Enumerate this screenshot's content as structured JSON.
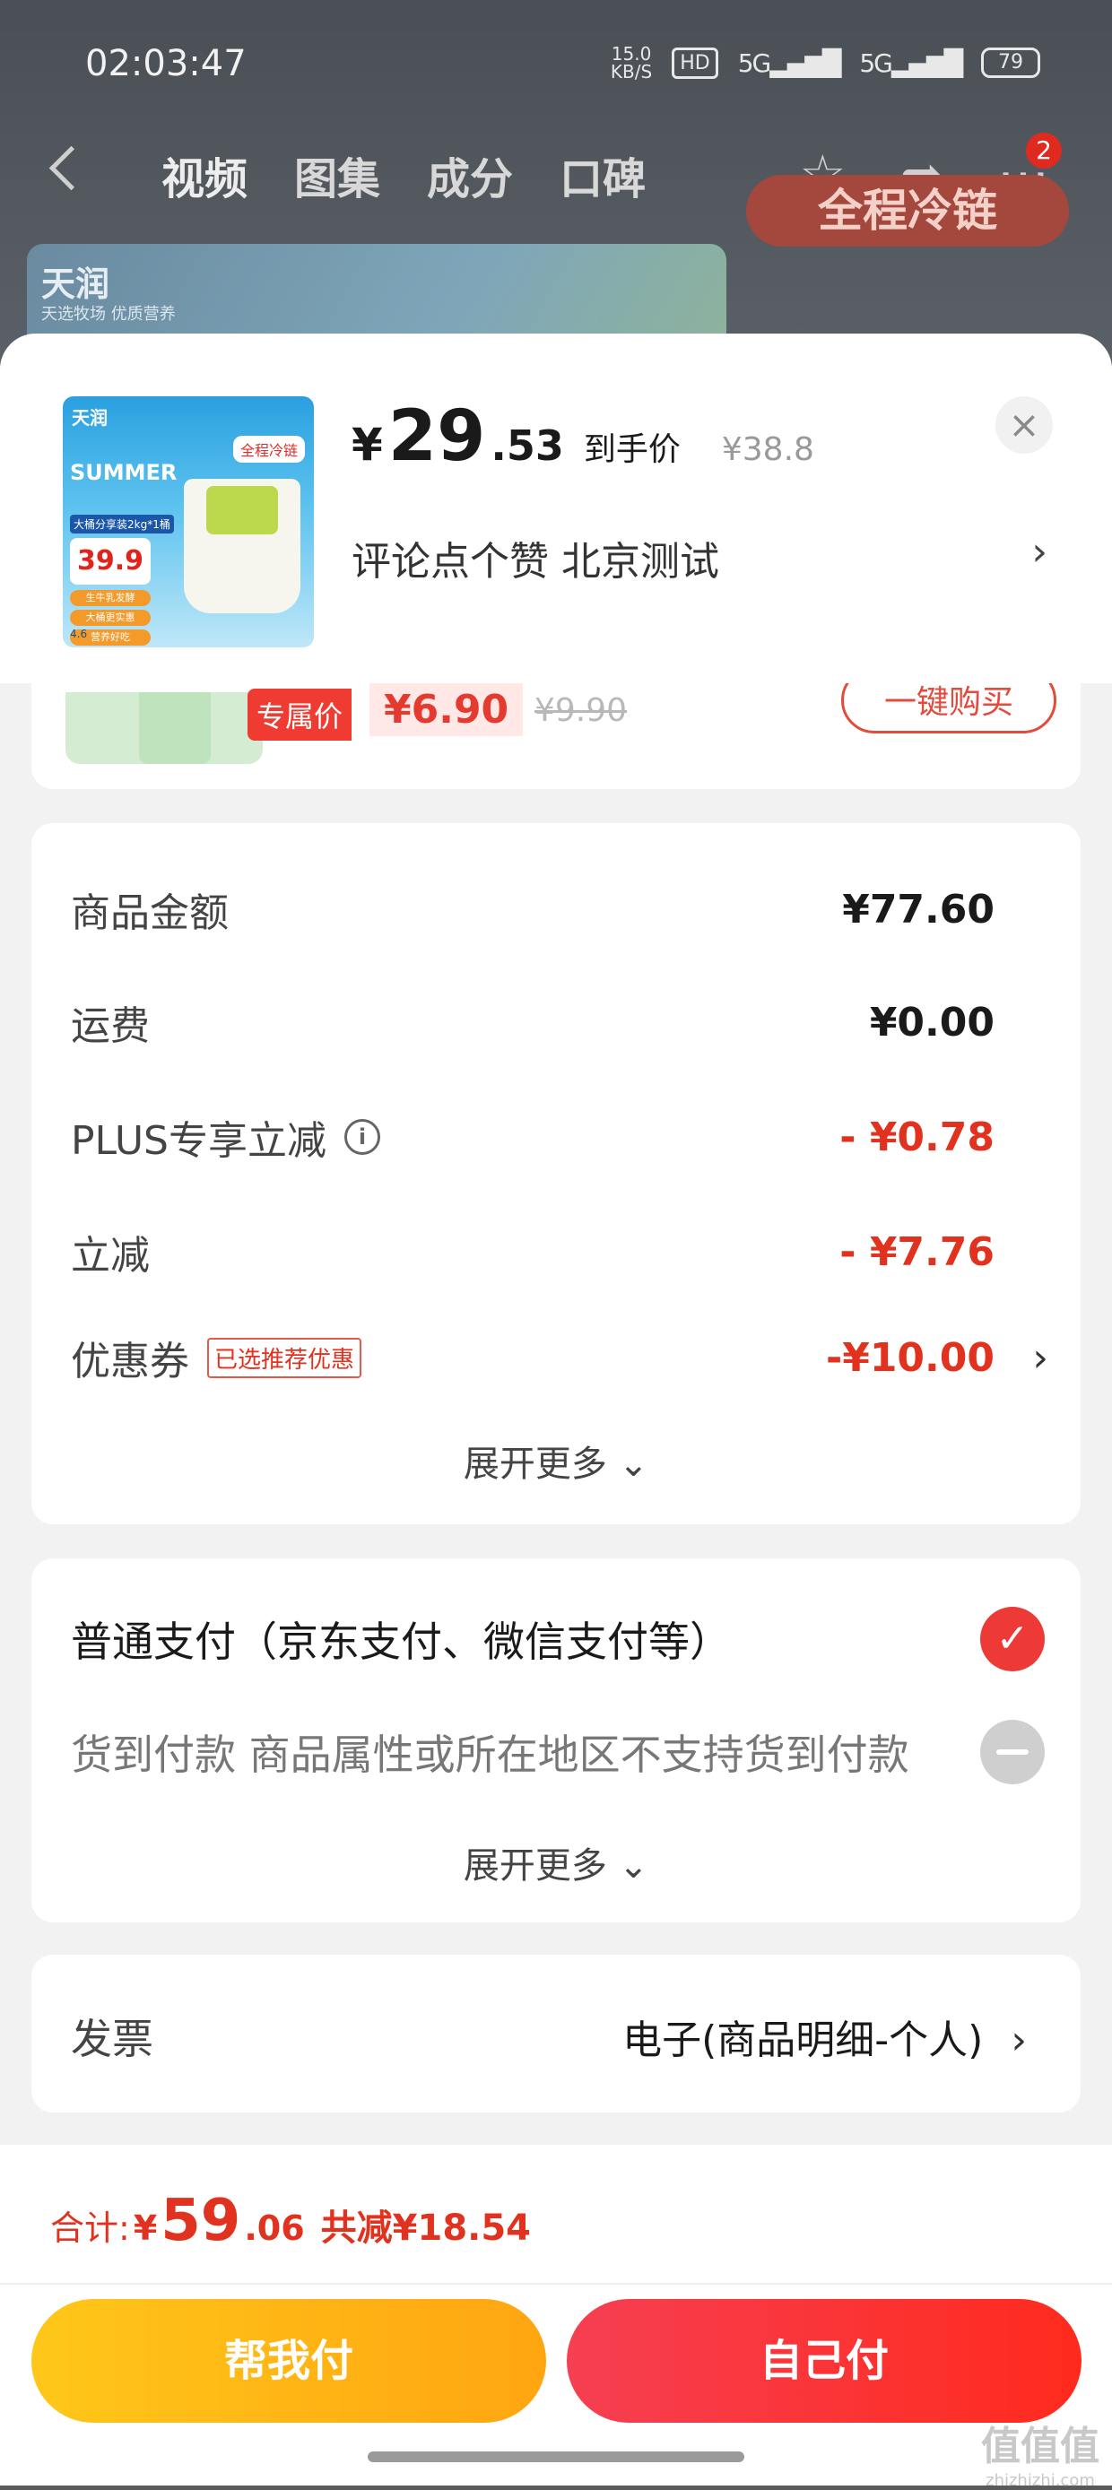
{
  "status_bar": {
    "time": "02:03:47",
    "net_speed": "15.0",
    "net_unit": "KB/S",
    "hd": "HD",
    "signal1": "5G",
    "signal2": "5G",
    "battery": "79"
  },
  "nav": {
    "tabs": [
      "视频",
      "图集",
      "成分",
      "口碑"
    ],
    "cart_badge": "2"
  },
  "background": {
    "brand": "天润",
    "brand_sub": "天选牧场 优质营养",
    "promo": "全程冷链"
  },
  "product": {
    "price_symbol": "¥",
    "price_int": "29",
    "price_dec": ".53",
    "price_label": "到手价",
    "original_price": "¥38.8",
    "description": "评论点个赞  北京测试",
    "thumb": {
      "brand": "天润",
      "tag": "全程冷链",
      "title": "SUMMER",
      "desc": "大桶分享装2kg*1桶",
      "price": "39.9",
      "features": [
        "生牛乳发酵",
        "大桶更实惠",
        "营养好吃"
      ],
      "footer": "4.6"
    }
  },
  "gift": {
    "exclusive_label": "专属价",
    "exclusive_price": "¥6.90",
    "original_price": "¥9.90",
    "buy_label": "一键购买"
  },
  "amounts": {
    "rows": [
      {
        "label": "商品金额",
        "value": "¥77.60"
      },
      {
        "label": "运费",
        "value": "¥0.00"
      },
      {
        "label": "PLUS专享立减",
        "value": "- ¥0.78"
      },
      {
        "label": "立减",
        "value": "- ¥7.76"
      },
      {
        "label": "优惠券",
        "tag": "已选推荐优惠",
        "value": "-¥10.00"
      }
    ],
    "expand_label": "展开更多"
  },
  "payment": {
    "normal": "普通支付（京东支付、微信支付等）",
    "cod": "货到付款 商品属性或所在地区不支持货到付款",
    "expand_label": "展开更多"
  },
  "invoice": {
    "label": "发票",
    "value": "电子(商品明细-个人)"
  },
  "total": {
    "label": "合计: ",
    "symbol": "¥",
    "int": "59",
    "dec": ".06",
    "save": "共减¥18.54"
  },
  "buttons": {
    "help_pay": "帮我付",
    "self_pay": "自己付"
  },
  "watermark": {
    "text": "值值值",
    "site": "zhizhizhi.com"
  },
  "colors": {
    "accent_red": "#e0321f",
    "button_yellow": "#ffb414",
    "button_red": "#f7373a"
  }
}
